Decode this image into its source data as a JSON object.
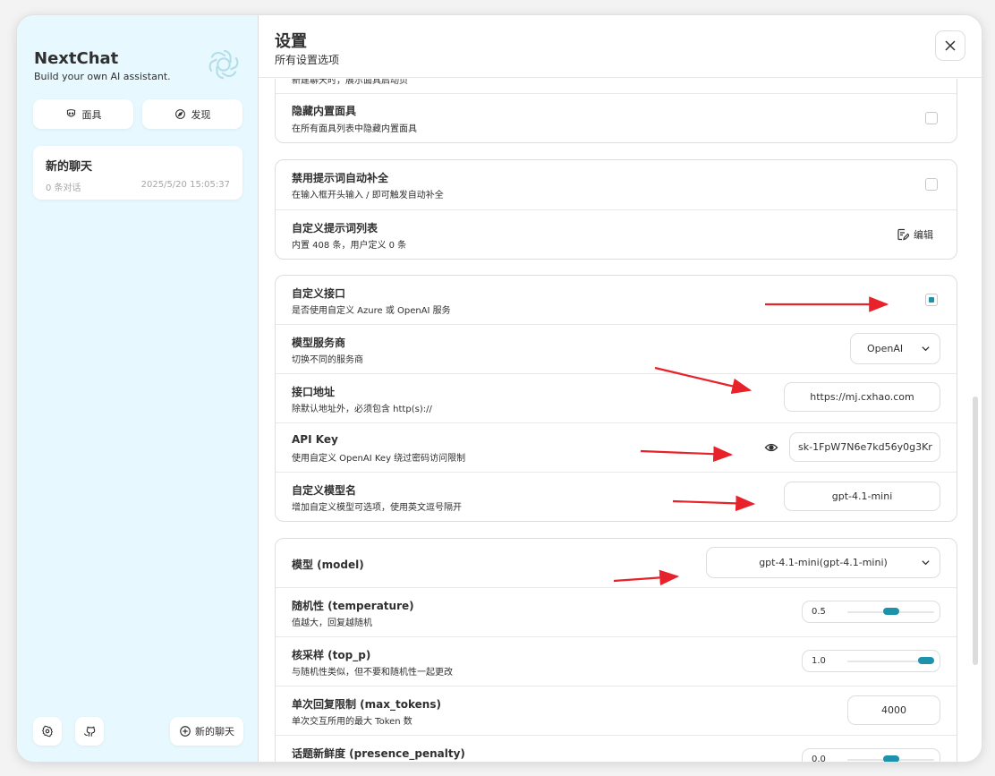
{
  "colors": {
    "accent": "#1d93ab",
    "sidebar_bg": "#e7f8ff",
    "annotation_arrow": "#e8222a"
  },
  "sidebar": {
    "title": "NextChat",
    "subtitle": "Build your own AI assistant.",
    "mask_label": "面具",
    "discover_label": "发现",
    "chat": {
      "title": "新的聊天",
      "count": "0 条对话",
      "time": "2025/5/20 15:05:37"
    },
    "new_chat_label": "新的聊天"
  },
  "header": {
    "title": "设置",
    "subtitle": "所有设置选项"
  },
  "settings": {
    "partial_row_sub": "新建聊天时，展示面具启动页",
    "hide_builtin_masks": {
      "title": "隐藏内置面具",
      "sub": "在所有面具列表中隐藏内置面具",
      "checked": false
    },
    "disable_prompt_autocomplete": {
      "title": "禁用提示词自动补全",
      "sub": "在输入框开头输入 / 即可触发自动补全",
      "checked": false
    },
    "custom_prompt_list": {
      "title": "自定义提示词列表",
      "sub": "内置 408 条，用户定义 0 条",
      "edit_label": "编辑"
    },
    "custom_endpoint": {
      "title": "自定义接口",
      "sub": "是否使用自定义 Azure 或 OpenAI 服务",
      "checked": true
    },
    "provider": {
      "title": "模型服务商",
      "sub": "切换不同的服务商",
      "value": "OpenAI"
    },
    "endpoint": {
      "title": "接口地址",
      "sub": "除默认地址外，必须包含 http(s)://",
      "value": "https://mj.cxhao.com"
    },
    "api_key": {
      "title": "API Key",
      "sub": "使用自定义 OpenAI Key 绕过密码访问限制",
      "value": "sk-1FpW7N6e7kd56y0g3Kr"
    },
    "custom_models": {
      "title": "自定义模型名",
      "sub": "增加自定义模型可选项，使用英文逗号隔开",
      "value": "gpt-4.1-mini"
    },
    "model": {
      "title": "模型 (model)",
      "value": "gpt-4.1-mini(gpt-4.1-mini)"
    },
    "temperature": {
      "title": "随机性 (temperature)",
      "sub": "值越大，回复越随机",
      "value": "0.5",
      "level": 0.5
    },
    "top_p": {
      "title": "核采样 (top_p)",
      "sub": "与随机性类似，但不要和随机性一起更改",
      "value": "1.0",
      "level": 1.0
    },
    "max_tokens": {
      "title": "单次回复限制 (max_tokens)",
      "sub": "单次交互所用的最大 Token 数",
      "value": "4000"
    },
    "presence_penalty": {
      "title": "话题新鲜度 (presence_penalty)",
      "value": "0.0",
      "level": 0.5
    }
  }
}
